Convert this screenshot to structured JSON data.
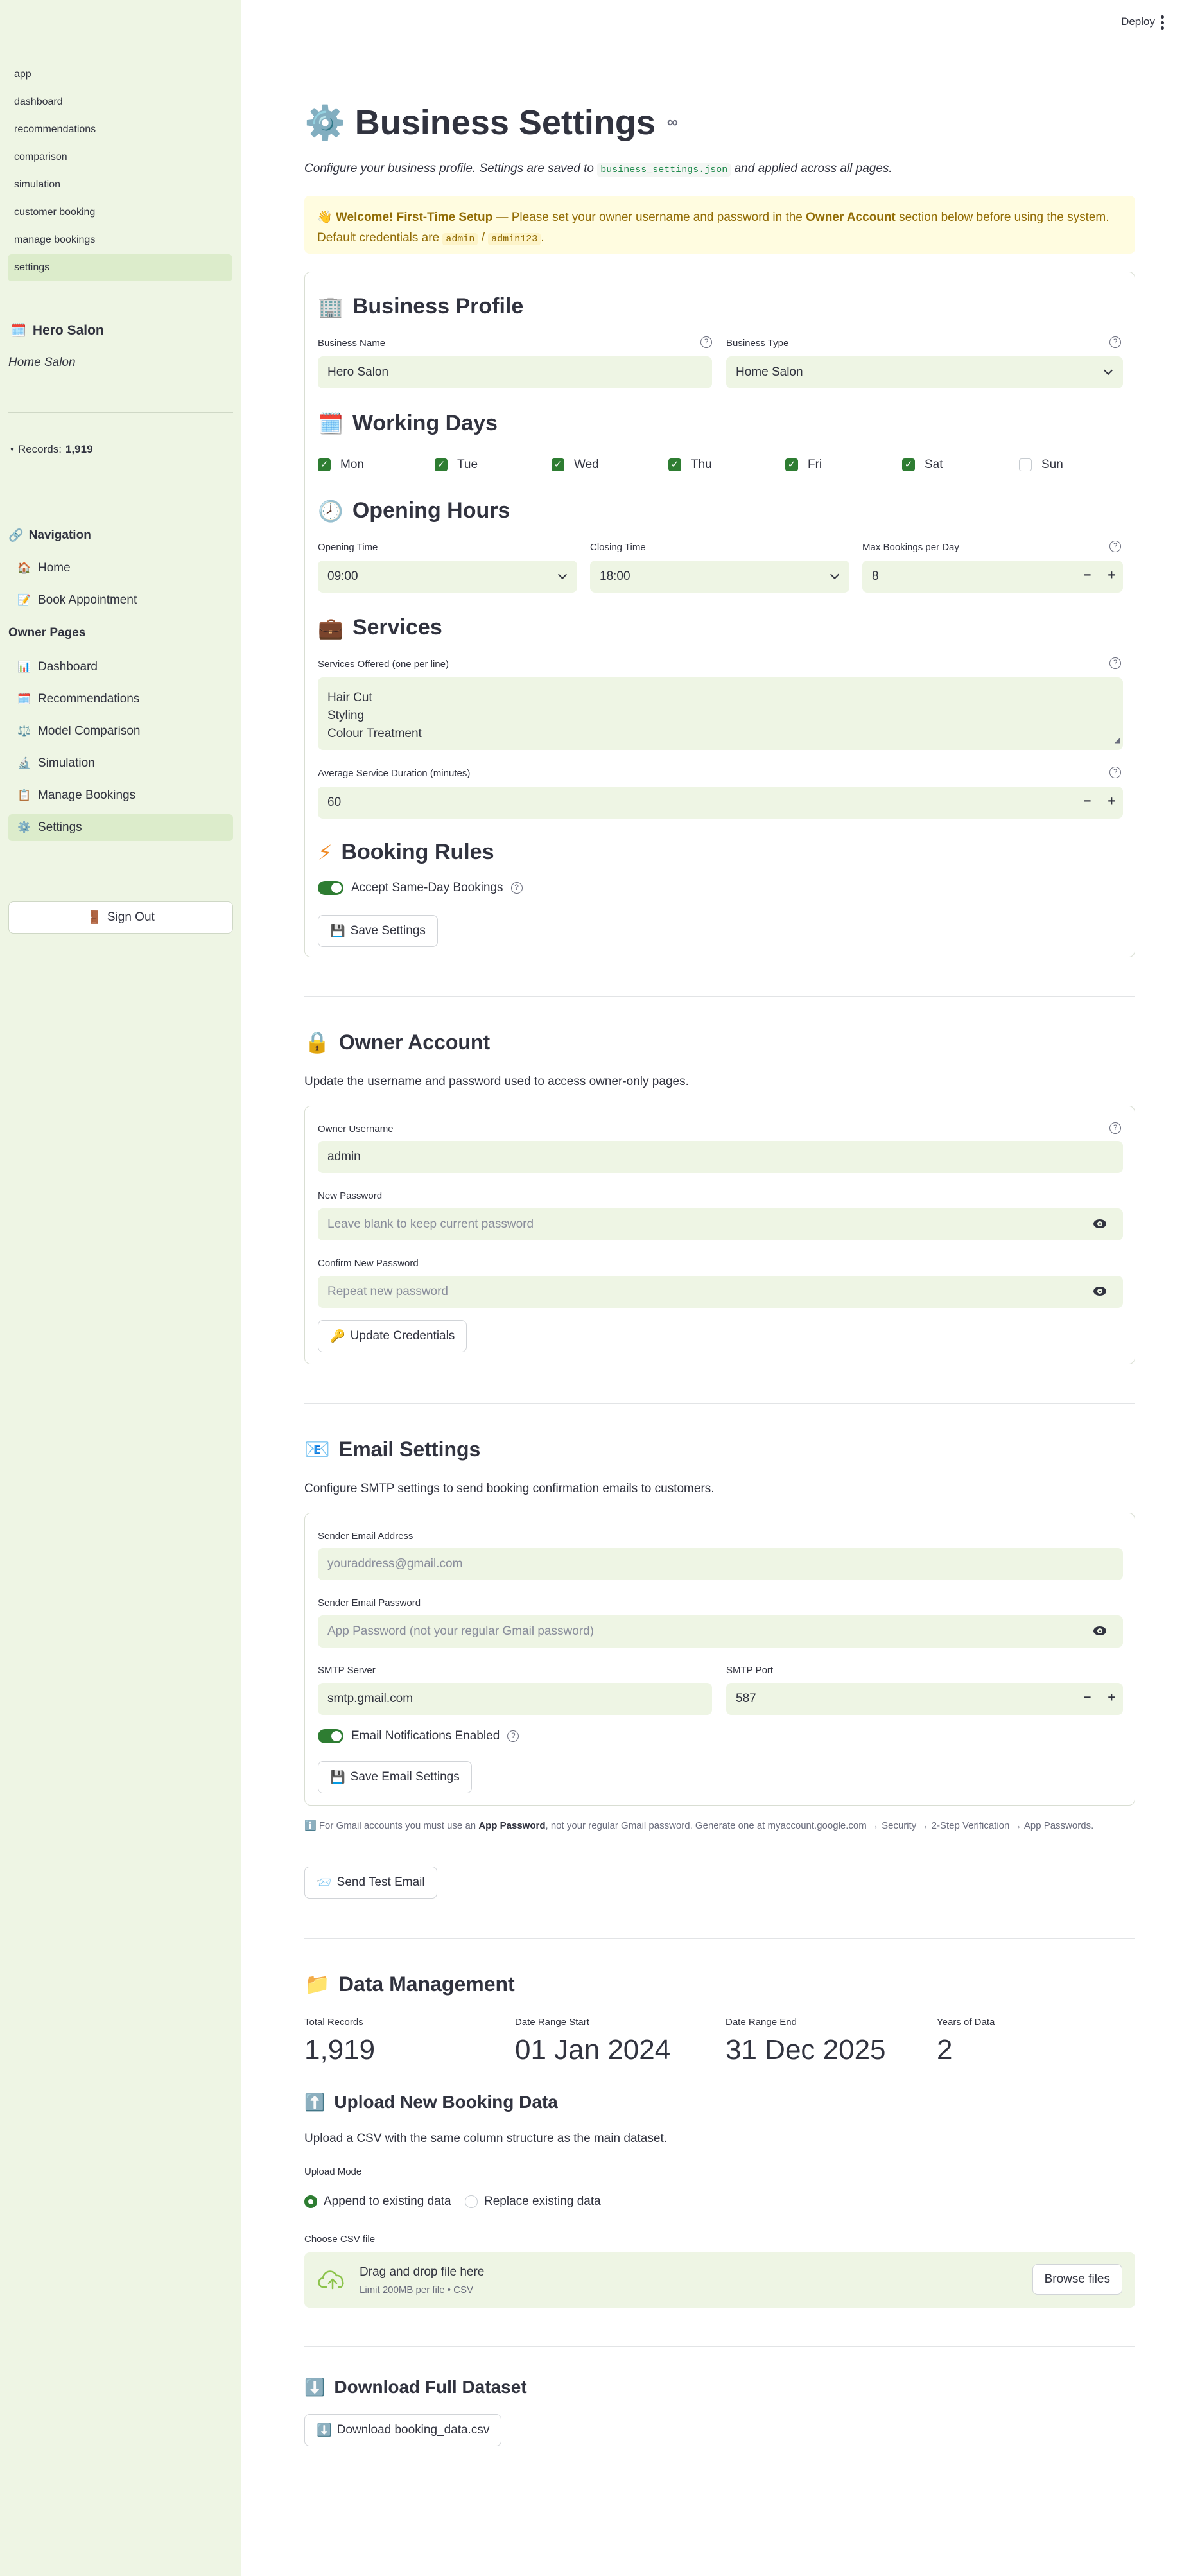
{
  "sidebar": {
    "pages": [
      "app",
      "dashboard",
      "recommendations",
      "comparison",
      "simulation",
      "customer booking",
      "manage bookings",
      "settings"
    ],
    "active_page": "settings",
    "business_name": "Hero Salon",
    "business_type": "Home Salon",
    "records_label": "Records:",
    "records_value": "1,919",
    "nav_heading": "Navigation",
    "nav_items": [
      {
        "label": "Home",
        "icon": "house-icon"
      },
      {
        "label": "Book Appointment",
        "icon": "memo-icon"
      }
    ],
    "owner_heading": "Owner Pages",
    "owner_items": [
      {
        "label": "Dashboard",
        "icon": "bar-chart-icon"
      },
      {
        "label": "Recommendations",
        "icon": "calendar-icon"
      },
      {
        "label": "Model Comparison",
        "icon": "scales-icon"
      },
      {
        "label": "Simulation",
        "icon": "microscope-icon"
      },
      {
        "label": "Manage Bookings",
        "icon": "clipboard-icon"
      },
      {
        "label": "Settings",
        "icon": "gear-icon"
      }
    ],
    "sign_out": "Sign Out"
  },
  "header": {
    "deploy": "Deploy"
  },
  "page": {
    "title": "Business Settings",
    "intro_before": "Configure your business profile. Settings are saved to",
    "intro_file": "business_settings.json",
    "intro_after": "and applied across all pages.",
    "warning_title": "Welcome! First-Time Setup",
    "warning_text_1": "— Please set your owner username and password in the",
    "warning_bold": "Owner Account",
    "warning_text_2": "section below before using the system. Default credentials are",
    "warning_user": "admin",
    "warning_sep": "/",
    "warning_pass": "admin123",
    "warning_end": "."
  },
  "profile": {
    "title": "Business Profile",
    "name_label": "Business Name",
    "name_value": "Hero Salon",
    "type_label": "Business Type",
    "type_value": "Home Salon"
  },
  "working_days": {
    "title": "Working Days",
    "days": [
      {
        "label": "Mon",
        "checked": true
      },
      {
        "label": "Tue",
        "checked": true
      },
      {
        "label": "Wed",
        "checked": true
      },
      {
        "label": "Thu",
        "checked": true
      },
      {
        "label": "Fri",
        "checked": true
      },
      {
        "label": "Sat",
        "checked": true
      },
      {
        "label": "Sun",
        "checked": false
      }
    ]
  },
  "hours": {
    "title": "Opening Hours",
    "open_label": "Opening Time",
    "open_value": "09:00",
    "close_label": "Closing Time",
    "close_value": "18:00",
    "max_label": "Max Bookings per Day",
    "max_value": "8"
  },
  "services": {
    "title": "Services",
    "offered_label": "Services Offered (one per line)",
    "offered_lines": [
      "Hair Cut",
      "Styling",
      "Colour Treatment"
    ],
    "duration_label": "Average Service Duration (minutes)",
    "duration_value": "60"
  },
  "rules": {
    "title": "Booking Rules",
    "same_day_label": "Accept Same-Day Bookings",
    "same_day_on": true,
    "save_label": "Save Settings"
  },
  "owner": {
    "title": "Owner Account",
    "desc": "Update the username and password used to access owner-only pages.",
    "username_label": "Owner Username",
    "username_value": "admin",
    "new_pw_label": "New Password",
    "new_pw_placeholder": "Leave blank to keep current password",
    "confirm_label": "Confirm New Password",
    "confirm_placeholder": "Repeat new password",
    "update_label": "Update Credentials"
  },
  "email": {
    "title": "Email Settings",
    "desc": "Configure SMTP settings to send booking confirmation emails to customers.",
    "sender_label": "Sender Email Address",
    "sender_placeholder": "youraddress@gmail.com",
    "pw_label": "Sender Email Password",
    "pw_placeholder": "App Password (not your regular Gmail password)",
    "server_label": "SMTP Server",
    "server_value": "smtp.gmail.com",
    "port_label": "SMTP Port",
    "port_value": "587",
    "notif_label": "Email Notifications Enabled",
    "notif_on": true,
    "save_label": "Save Email Settings",
    "note_before": "For Gmail accounts you must use an",
    "note_bold": "App Password",
    "note_after": ", not your regular Gmail password. Generate one at myaccount.google.com → Security → 2-Step Verification → App Passwords.",
    "test_label": "Send Test Email"
  },
  "data": {
    "title": "Data Management",
    "metrics": [
      {
        "label": "Total Records",
        "value": "1,919"
      },
      {
        "label": "Date Range Start",
        "value": "01 Jan 2024"
      },
      {
        "label": "Date Range End",
        "value": "31 Dec 2025"
      },
      {
        "label": "Years of Data",
        "value": "2"
      }
    ],
    "upload_title": "Upload New Booking Data",
    "upload_desc": "Upload a CSV with the same column structure as the main dataset.",
    "mode_label": "Upload Mode",
    "mode_options": [
      "Append to existing data",
      "Replace existing data"
    ],
    "mode_selected": "Append to existing data",
    "file_label": "Choose CSV file",
    "drop_title": "Drag and drop file here",
    "drop_limit": "Limit 200MB per file • CSV",
    "browse_label": "Browse files",
    "download_title": "Download Full Dataset",
    "download_label": "Download booking_data.csv"
  }
}
